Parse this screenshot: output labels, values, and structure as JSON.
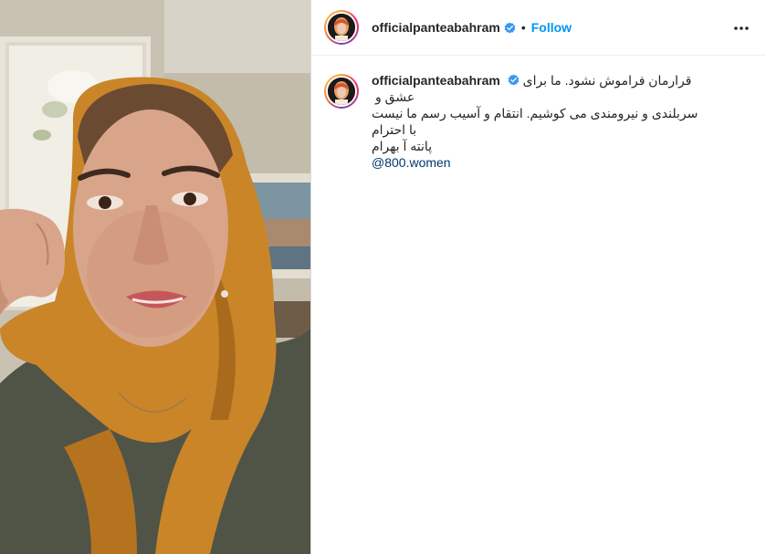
{
  "post": {
    "username": "officialpanteabahram",
    "verified": true,
    "separator": "•",
    "follow_label": "Follow",
    "more_icon": "more-horizontal-icon",
    "media_description_icon": "video-frame"
  },
  "caption": {
    "username": "officialpanteabahram",
    "line1_tail": "قرارمان فراموش نشود. ما برای عشق و",
    "line2": "سربلندی و نیرومندی می کوشیم. انتقام و آسیب رسم ما نیست",
    "line3": "با احترام",
    "line4": "پانته آ بهرام",
    "mention": "@800.women"
  },
  "colors": {
    "follow": "#0095f6",
    "verified": "#3897f0",
    "mention": "#00376b",
    "text": "#262626"
  }
}
